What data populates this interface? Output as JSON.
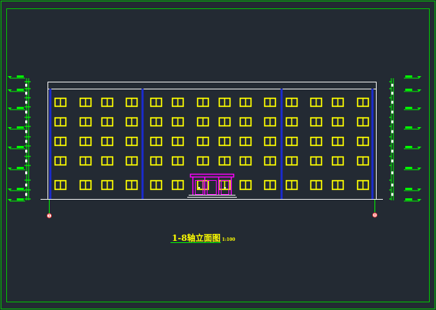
{
  "drawing": {
    "title": "1-8轴立面图",
    "scale": "1:100",
    "axis_left": "1",
    "axis_right": "8"
  },
  "colors": {
    "background": "#232a33",
    "frame": "#00cc00",
    "outline": "#ffffff",
    "window": "#ffff00",
    "column": "#1a2bd0",
    "entrance": "#ff00ff",
    "dimension": "#00ff00",
    "axis_marker": "#ff4040"
  },
  "building": {
    "floors": 5,
    "window_columns": 14
  }
}
